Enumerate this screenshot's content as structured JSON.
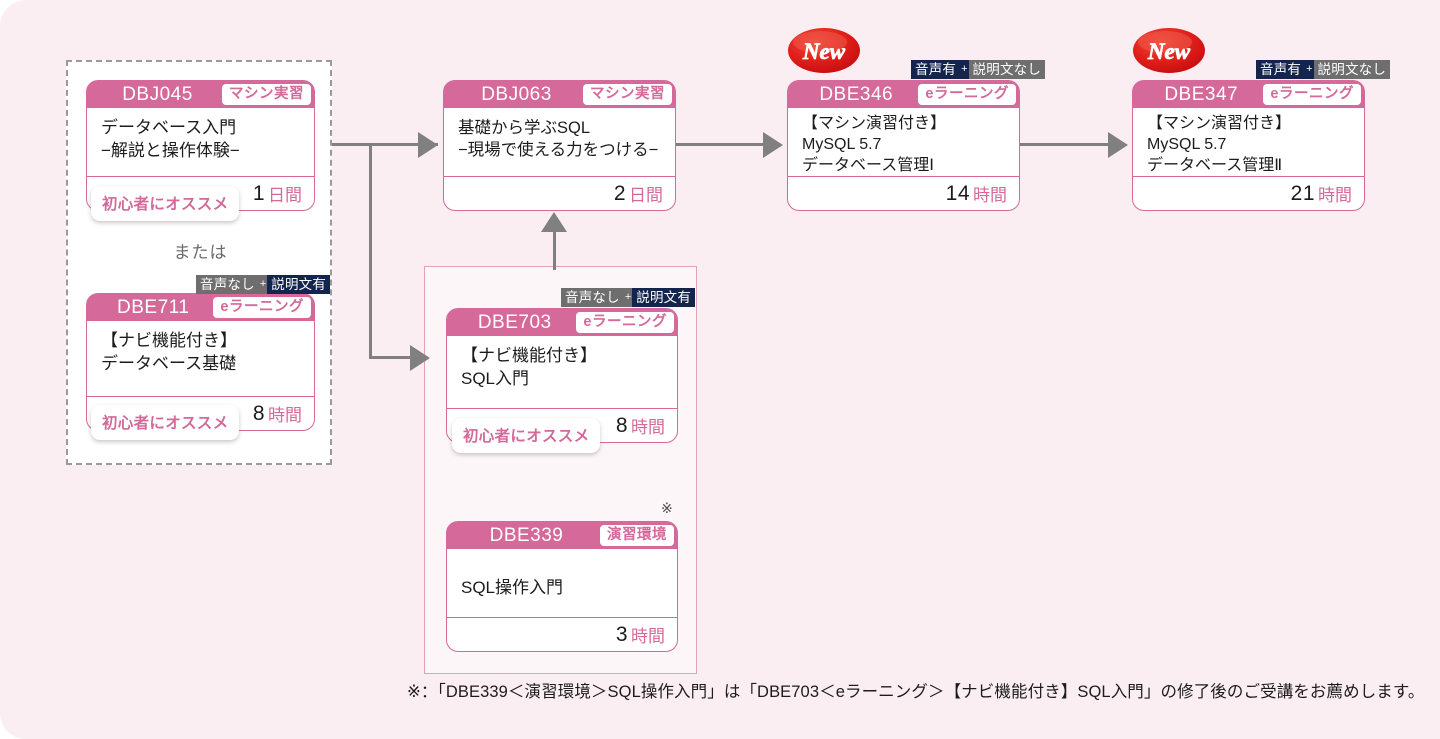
{
  "page": {
    "background_color": "#fbeef3",
    "accent_color": "#d4699a",
    "connector_color": "#808080"
  },
  "group_or": {
    "label": "または"
  },
  "note_marker": "※",
  "badges": {
    "new_label": "New",
    "recommended_label": "初心者にオススメ",
    "audio_on": "音声有",
    "audio_off": "音声なし",
    "caption_on": "説明文有",
    "caption_off": "説明文なし",
    "plus": "+"
  },
  "cards": {
    "dbj045": {
      "code": "DBJ045",
      "tag": "マシン実習",
      "title": "データベース入門\n−解説と操作体験−",
      "duration_value": "1",
      "duration_unit": "日間",
      "recommended": "初心者にオススメ"
    },
    "dbe711": {
      "code": "DBE711",
      "tag": "eラーニング",
      "title": "【ナビ機能付き】\nデータベース基礎",
      "duration_value": "8",
      "duration_unit": "時間",
      "recommended": "初心者にオススメ",
      "av_first": "音声なし",
      "av_second": "説明文有"
    },
    "dbj063": {
      "code": "DBJ063",
      "tag": "マシン実習",
      "title": "基礎から学ぶSQL\n−現場で使える力をつける−",
      "duration_value": "2",
      "duration_unit": "日間"
    },
    "dbe346": {
      "code": "DBE346",
      "tag": "eラーニング",
      "title": "【マシン演習付き】\nMySQL 5.7\nデータベース管理Ⅰ",
      "duration_value": "14",
      "duration_unit": "時間",
      "new": "New",
      "av_first": "音声有",
      "av_second": "説明文なし"
    },
    "dbe347": {
      "code": "DBE347",
      "tag": "eラーニング",
      "title": "【マシン演習付き】\nMySQL 5.7\nデータベース管理Ⅱ",
      "duration_value": "21",
      "duration_unit": "時間",
      "new": "New",
      "av_first": "音声有",
      "av_second": "説明文なし"
    },
    "dbe703": {
      "code": "DBE703",
      "tag": "eラーニング",
      "title": "【ナビ機能付き】\nSQL入門",
      "duration_value": "8",
      "duration_unit": "時間",
      "recommended": "初心者にオススメ",
      "av_first": "音声なし",
      "av_second": "説明文有"
    },
    "dbe339": {
      "code": "DBE339",
      "tag": "演習環境",
      "title": "SQL操作入門",
      "duration_value": "3",
      "duration_unit": "時間",
      "note_mark": "※"
    }
  },
  "footnote": {
    "text": "※：「DBE339＜演習環境＞SQL操作入門」は「DBE703＜eラーニング＞【ナビ機能付き】SQL入門」の修了後のご受講をお薦めします。"
  }
}
